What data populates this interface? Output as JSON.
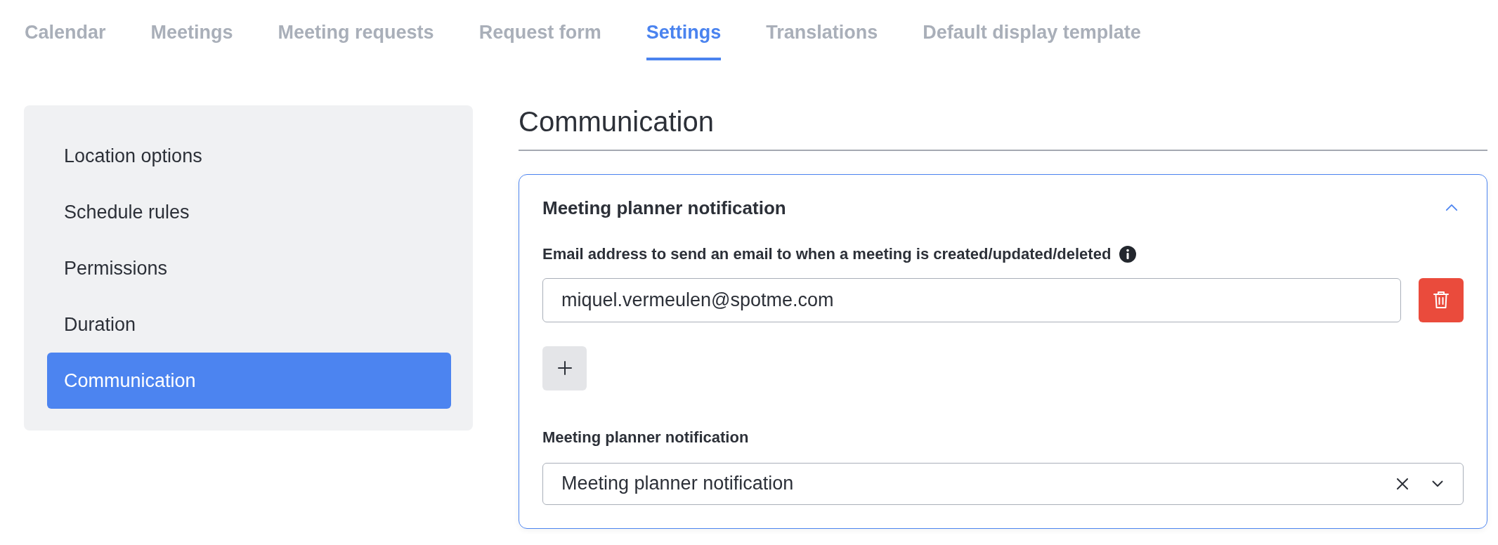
{
  "tabs": [
    {
      "label": "Calendar",
      "selected": false
    },
    {
      "label": "Meetings",
      "selected": false
    },
    {
      "label": "Meeting requests",
      "selected": false
    },
    {
      "label": "Request form",
      "selected": false
    },
    {
      "label": "Settings",
      "selected": true
    },
    {
      "label": "Translations",
      "selected": false
    },
    {
      "label": "Default display template",
      "selected": false
    }
  ],
  "sidebar": {
    "items": [
      {
        "label": "Location options",
        "selected": false
      },
      {
        "label": "Schedule rules",
        "selected": false
      },
      {
        "label": "Permissions",
        "selected": false
      },
      {
        "label": "Duration",
        "selected": false
      },
      {
        "label": "Communication",
        "selected": true
      }
    ]
  },
  "section": {
    "title": "Communication",
    "panel": {
      "title": "Meeting planner notification",
      "expanded": true,
      "email_field": {
        "label": "Email address to send an email to when a meeting is created/updated/deleted",
        "entries": [
          {
            "value": "miquel.vermeulen@spotme.com"
          }
        ]
      },
      "template_select": {
        "label": "Meeting planner notification",
        "value": "Meeting planner notification"
      }
    }
  }
}
